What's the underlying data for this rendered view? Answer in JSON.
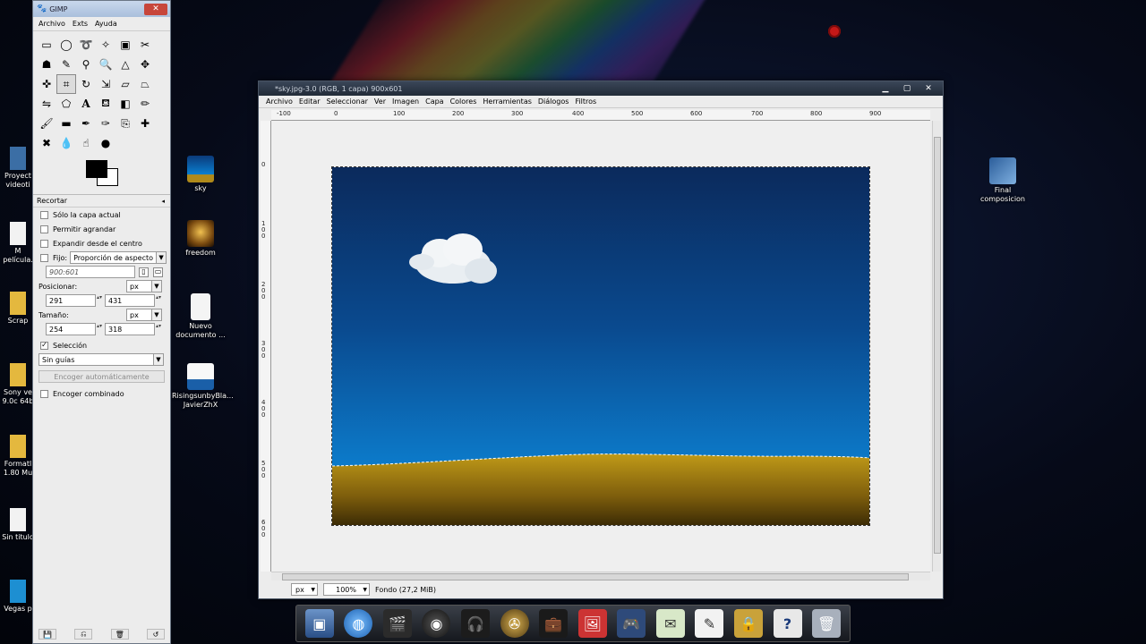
{
  "gimp_toolbox": {
    "title": "GIMP",
    "menu": [
      "Archivo",
      "Exts",
      "Ayuda"
    ],
    "tool_options": {
      "header": "Recortar",
      "only_current_layer": "Sólo la capa actual",
      "allow_growing": "Permitir agrandar",
      "expand_from_center": "Expandir desde el centro",
      "fixed_label": "Fijo:",
      "fixed_mode": "Proporción de aspecto",
      "ratio_value": "900:601",
      "position_label": "Posicionar:",
      "position_unit": "px",
      "pos_x": "291",
      "pos_y": "431",
      "size_label": "Tamaño:",
      "size_unit": "px",
      "size_w": "254",
      "size_h": "318",
      "selection_label": "Selección",
      "guides_value": "Sin guías",
      "autoshrink_button": "Encoger automáticamente",
      "combined_shrink": "Encoger combinado"
    }
  },
  "image_window": {
    "title": "*sky.jpg-3.0 (RGB, 1 capa) 900x601",
    "menu": [
      "Archivo",
      "Editar",
      "Seleccionar",
      "Ver",
      "Imagen",
      "Capa",
      "Colores",
      "Herramientas",
      "Diálogos",
      "Filtros"
    ],
    "ruler_h_labels": [
      "-100",
      "0",
      "100",
      "200",
      "300",
      "400",
      "500",
      "600",
      "700",
      "800",
      "900"
    ],
    "ruler_v_labels": [
      "0",
      "1 0 0",
      "2 0 0",
      "3 0 0",
      "4 0 0",
      "5 0 0",
      "6 0 0"
    ],
    "status": {
      "unit": "px",
      "zoom": "100%",
      "layer_info": "Fondo (27,2 MiB)"
    }
  },
  "desktop": {
    "icons_right": [
      {
        "label": "sky",
        "icon": "image-icon"
      },
      {
        "label": "freedom",
        "icon": "image-icon"
      },
      {
        "label": "Nuevo documento ...",
        "icon": "document-icon"
      },
      {
        "label": "RisingsunbyBla... JavierZhX",
        "icon": "brushes-icon"
      }
    ],
    "icon_far_right": {
      "label": "Final composicion",
      "icon": "video-project-icon"
    },
    "icons_left_partial": [
      "Proyect videoti",
      "M película.",
      "Scrap",
      "Sony ve 9.0c 64b",
      "Formatl 1.80 Mu",
      "Sin titulo",
      "Vegas p"
    ]
  },
  "dock": {
    "items": [
      "monitor-icon",
      "globe-icon",
      "clapperboard-icon",
      "speaker-icon",
      "headphones-icon",
      "film-reel-icon",
      "briefcase-icon",
      "paint-icon",
      "gamepad-icon",
      "mail-icon",
      "notes-icon",
      "lock-icon",
      "help-icon",
      "trash-icon"
    ]
  }
}
